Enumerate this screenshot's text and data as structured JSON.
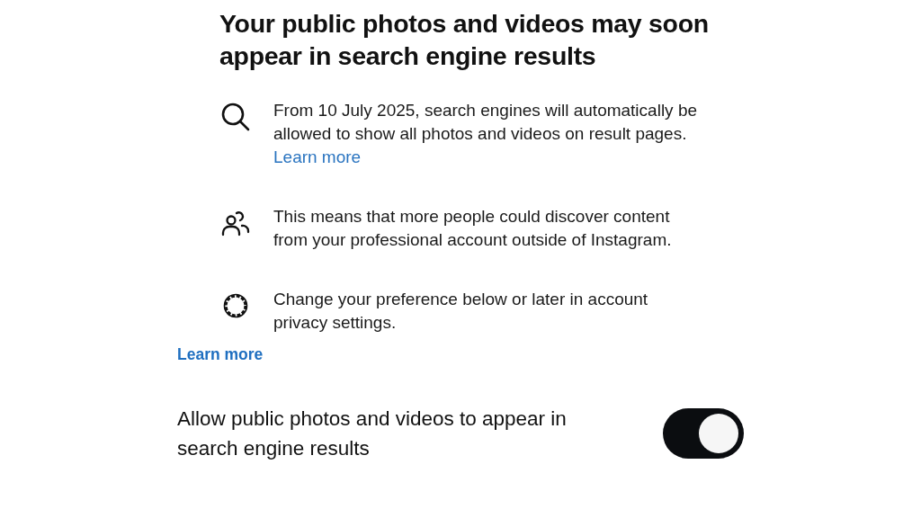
{
  "title": "Your public photos and videos may soon appear in search engine results",
  "items": [
    {
      "kind": "search",
      "text": "From 10 July 2025, search engines will automatically be allowed to show all photos and videos on result pages.",
      "link": "Learn more"
    },
    {
      "kind": "people",
      "text": "This means that more people could discover content from your professional account outside of Instagram."
    },
    {
      "kind": "gear",
      "text": "Change your preference below or later in account privacy settings."
    }
  ],
  "learn_more": "Learn more",
  "setting": {
    "label": "Allow public photos and videos to appear in search engine results",
    "on": true
  }
}
